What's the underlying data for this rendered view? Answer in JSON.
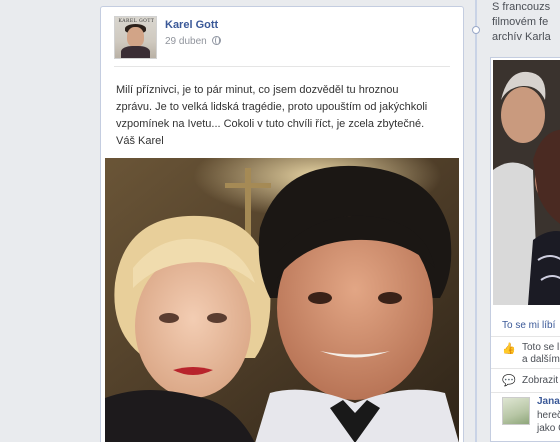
{
  "post": {
    "author": "Karel Gott",
    "date": "29 duben",
    "avatar_caption": "KAREL GOTT",
    "text_lines": [
      "Milí příznivci, je to pár minut, co jsem dozvěděl tu hroznou",
      "zprávu. Je to velká lidská tragédie, proto upouštím od jakýchkoli",
      "vzpomínek na Ivetu... Cokoli v tuto chvíli říct, je zcela zbytečné.",
      "Váš Karel"
    ],
    "privacy_icon": "globe-icon",
    "photo_icon": "photo-of-two-people"
  },
  "sidebar": {
    "text_lines": [
      "S francouzs",
      "filmovém fe",
      "archív Karla"
    ],
    "like_link": "To se mi líbí",
    "likes_row": [
      "Toto se lí",
      "a dalším"
    ],
    "show_row": "Zobrazit",
    "comment": {
      "name": "Jana",
      "lines": [
        "hereč",
        "jako C"
      ]
    }
  },
  "colors": {
    "link": "#3b5998",
    "background": "#e9ebee",
    "card": "#ffffff"
  }
}
